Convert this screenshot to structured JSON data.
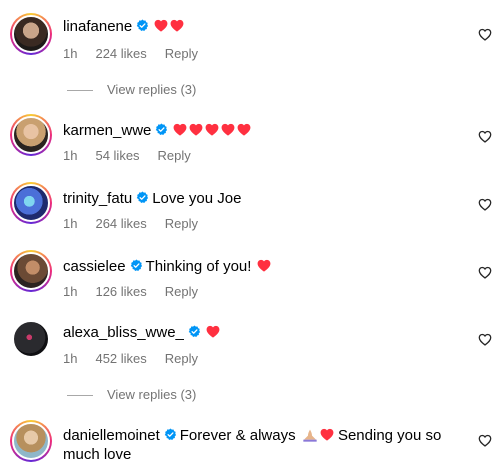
{
  "colors": {
    "verified": "#0095f6",
    "heart": "#ff3040",
    "meta": "#737373"
  },
  "comments": [
    {
      "username": "linafanene",
      "text": "",
      "hearts": 2,
      "time": "1h",
      "likes": "224 likes",
      "reply": "Reply",
      "view_replies": "View replies (3)"
    },
    {
      "username": "karmen_wwe",
      "text": "",
      "hearts": 5,
      "time": "1h",
      "likes": "54 likes",
      "reply": "Reply"
    },
    {
      "username": "trinity_fatu",
      "text": "Love you Joe",
      "time": "1h",
      "likes": "264 likes",
      "reply": "Reply"
    },
    {
      "username": "cassielee",
      "text": "Thinking of you!",
      "hearts": 1,
      "time": "1h",
      "likes": "126 likes",
      "reply": "Reply"
    },
    {
      "username": "alexa_bliss_wwe_",
      "text": "",
      "hearts": 1,
      "time": "1h",
      "likes": "452 likes",
      "reply": "Reply",
      "view_replies": "View replies (3)"
    },
    {
      "username": "daniellemoinet",
      "text_before": "Forever & always",
      "text_after": "Sending you so much love"
    }
  ],
  "icons": {
    "verified": "verified-badge-icon",
    "like": "heart-outline-icon",
    "heart_emoji": "red-heart-emoji",
    "pray_emoji": "praying-hands-emoji"
  }
}
